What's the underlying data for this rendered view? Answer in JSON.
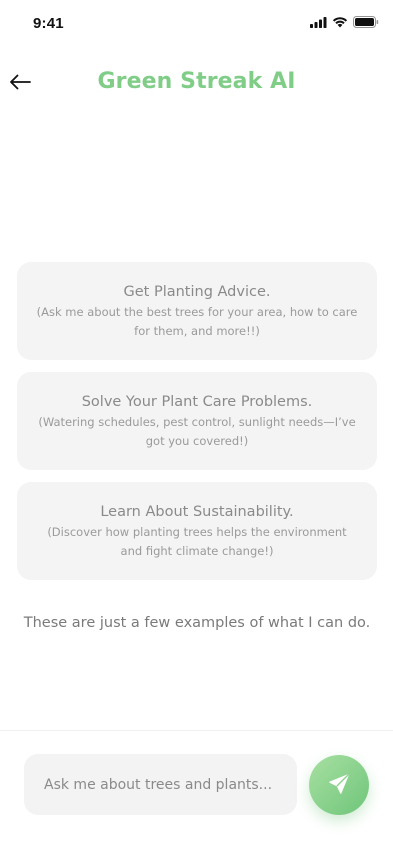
{
  "status_bar": {
    "time": "9:41",
    "icons": [
      "cellular-signal-icon",
      "wifi-icon",
      "battery-icon"
    ]
  },
  "header": {
    "back_icon": "arrow-left-icon",
    "title": "Green Streak AI"
  },
  "suggestions": [
    {
      "title": "Get Planting Advice.",
      "description": "(Ask me about the best trees for your area, how to care for them, and more!!)"
    },
    {
      "title": "Solve Your Plant Care Problems.",
      "description": "(Watering schedules, pest control, sunlight needs—I’ve got you covered!)"
    },
    {
      "title": "Learn About Sustainability.",
      "description": "(Discover how planting trees helps the environment and fight climate change!)"
    }
  ],
  "note": "These are just a few examples of what I can do.",
  "composer": {
    "placeholder": "Ask me about trees and plants...",
    "value": "",
    "send_icon": "send-icon"
  },
  "colors": {
    "brand_green": "#7fcd86",
    "send_gradient_start": "#a8e0a2",
    "send_gradient_end": "#6fc57a",
    "card_background": "#f4f4f4"
  }
}
